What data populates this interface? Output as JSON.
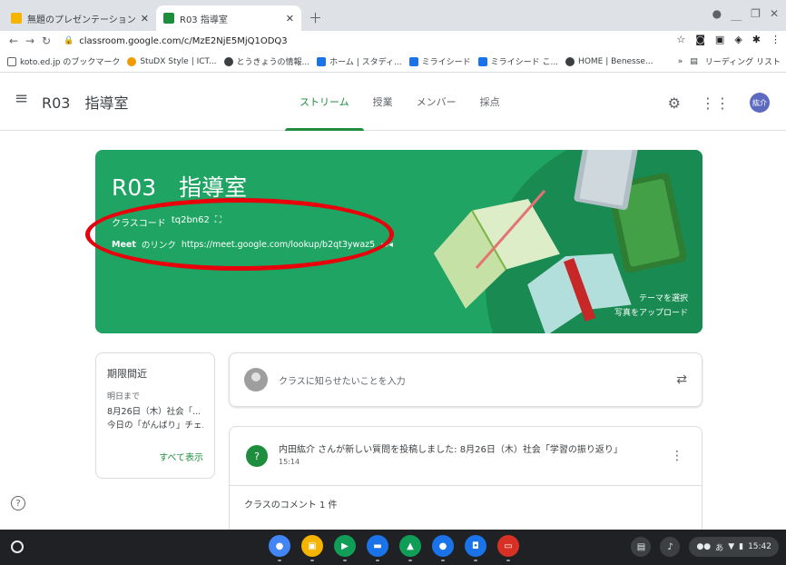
{
  "browser": {
    "tabs": [
      {
        "title": "無題のプレゼンテーション - G",
        "favicon_color": "#f4b400"
      },
      {
        "title": "R03 指導室",
        "favicon_color": "#1e8e3e"
      }
    ],
    "url": "classroom.google.com/c/MzE2NjE5MjQ1ODQ3"
  },
  "bookmarks": {
    "items": [
      {
        "label": "koto.ed.jp のブックマーク",
        "color": "#5f6368"
      },
      {
        "label": "StuDX Style | ICT...",
        "color": "#f29900"
      },
      {
        "label": "とうきょうの情報...",
        "color": "#3c4043"
      },
      {
        "label": "ホーム | スタディ...",
        "color": "#1a73e8"
      },
      {
        "label": "ミライシード",
        "color": "#1a73e8"
      },
      {
        "label": "ミライシード こ...",
        "color": "#1a73e8"
      },
      {
        "label": "HOME | Benesse...",
        "color": "#3c4043"
      }
    ],
    "overflow": "»",
    "reading_list": "リーディング リスト"
  },
  "header": {
    "class_name": "R03　指導室",
    "tabs": [
      "ストリーム",
      "授業",
      "メンバー",
      "採点"
    ],
    "active_tab": 0,
    "avatar_initials": "紘介"
  },
  "banner": {
    "title": "R03　指導室",
    "class_code_label": "クラスコード",
    "class_code": "tq2bn62",
    "meet_label": "Meet",
    "meet_suffix": "のリンク",
    "meet_url": "https://meet.google.com/lookup/b2qt3ywaz5",
    "select_theme": "テーマを選択",
    "upload_photo": "写真をアップロード",
    "color": "#1fa463"
  },
  "upcoming": {
    "title": "期限間近",
    "due": "明日まで",
    "items": [
      "8月26日（木）社会「...",
      "今日の「がんばり」チェ..."
    ],
    "view_all": "すべて表示"
  },
  "announce": {
    "placeholder": "クラスに知らせたいことを入力"
  },
  "post": {
    "title": "内田紘介 さんが新しい質問を投稿しました: 8月26日（木）社会「学習の振り返り」",
    "time": "15:14",
    "comments": "クラスのコメント 1 件"
  },
  "shelf": {
    "apps": [
      {
        "name": "chrome",
        "color": "#4285f4"
      },
      {
        "name": "classroom",
        "color": "#f4b400"
      },
      {
        "name": "play-store",
        "color": "#0f9d58"
      },
      {
        "name": "files",
        "color": "#1a73e8"
      },
      {
        "name": "drive",
        "color": "#0f9d58"
      },
      {
        "name": "meet",
        "color": "#1a73e8"
      },
      {
        "name": "camera",
        "color": "#1a73e8"
      },
      {
        "name": "slides",
        "color": "#d93025"
      }
    ],
    "ime": "あ",
    "time": "15:42"
  },
  "accent": "#1e8e3e"
}
